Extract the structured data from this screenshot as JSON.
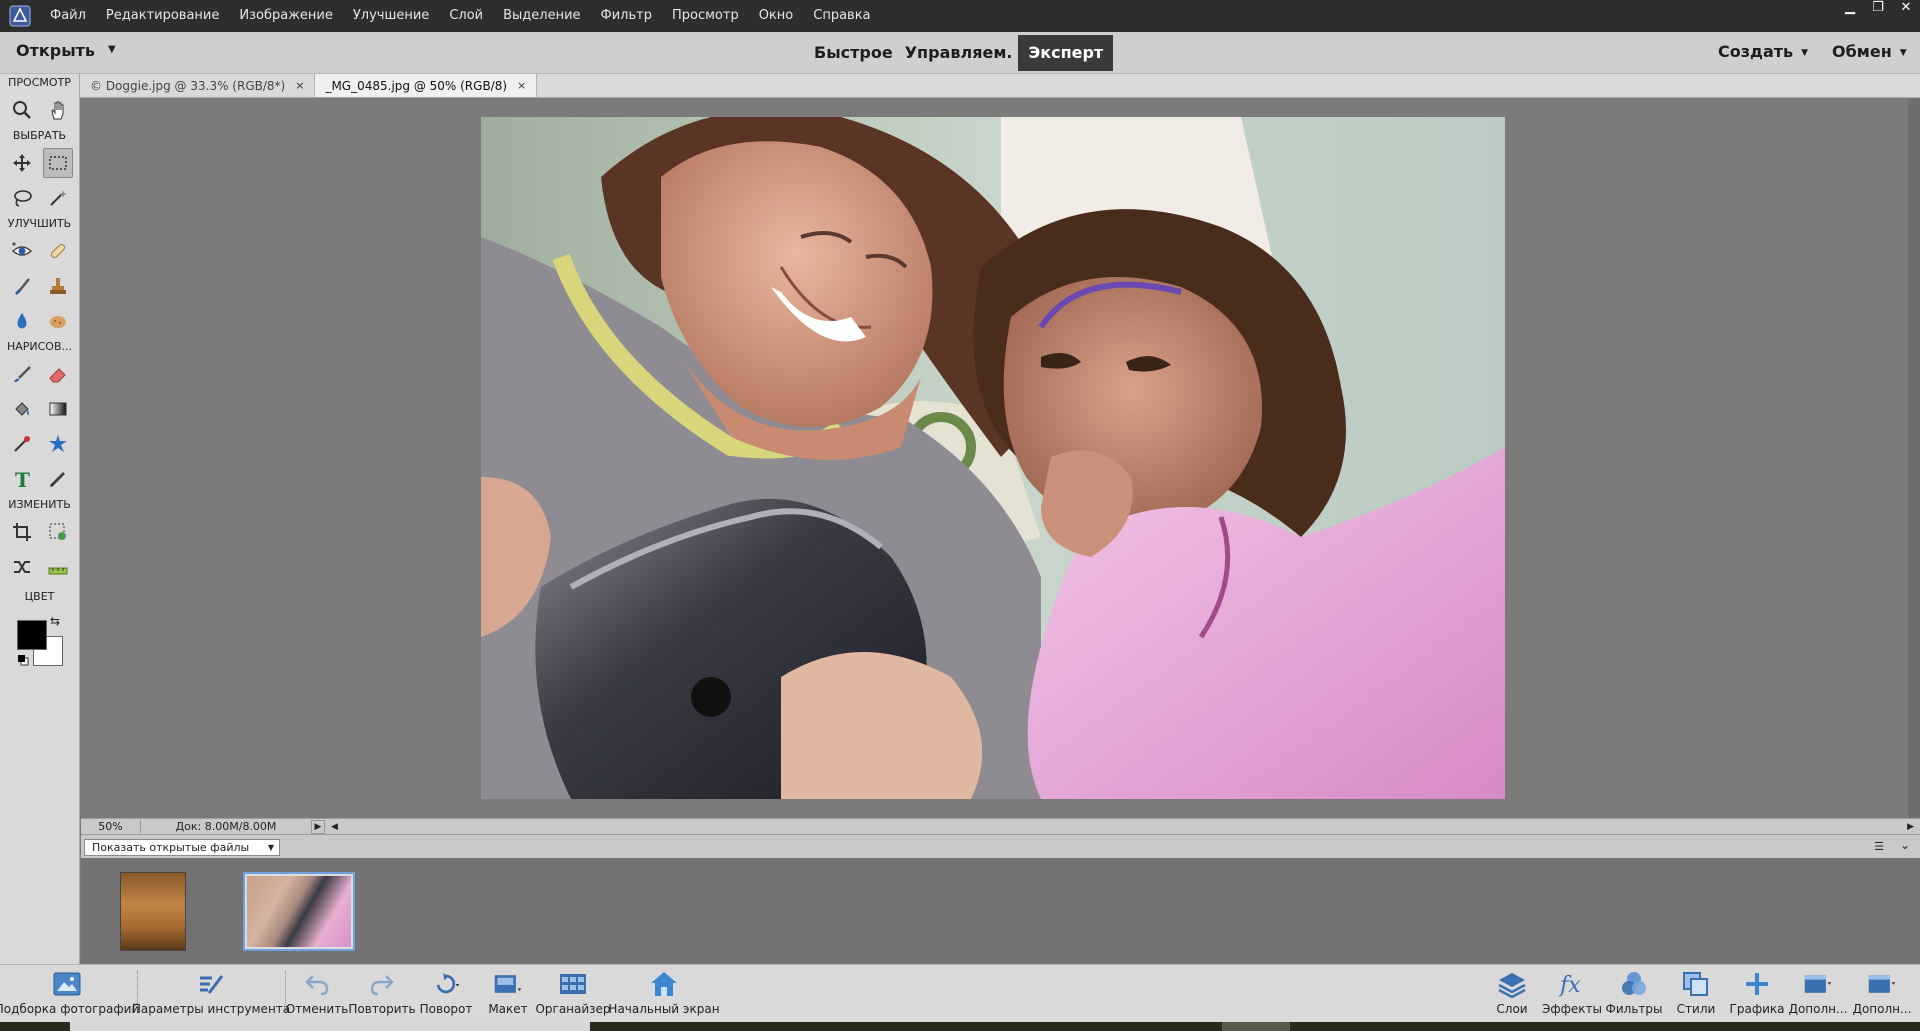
{
  "menu": {
    "items": [
      "Файл",
      "Редактирование",
      "Изображение",
      "Улучшение",
      "Слой",
      "Выделение",
      "Фильтр",
      "Просмотр",
      "Окно",
      "Справка"
    ]
  },
  "modebar": {
    "open_label": "Открыть",
    "modes": [
      "Быстрое",
      "Управляем.",
      "Эксперт"
    ],
    "active_mode": "Эксперт",
    "create_label": "Создать",
    "share_label": "Обмен"
  },
  "toolbox": {
    "sections": {
      "view": "ПРОСМОТР",
      "select": "ВЫБРАТЬ",
      "enhance": "УЛУЧШИТЬ",
      "draw": "НАРИСОВ...",
      "modify": "ИЗМЕНИТЬ",
      "color": "ЦВЕТ"
    },
    "fg_color": "#000000",
    "bg_color": "#ffffff"
  },
  "tabs": [
    {
      "label": "© Doggie.jpg @ 33.3% (RGB/8*)",
      "close": "×"
    },
    {
      "label": "_MG_0485.jpg @ 50% (RGB/8)",
      "close": "×"
    }
  ],
  "status": {
    "zoom": "50%",
    "doc_info": "Док: 8.00M/8.00M"
  },
  "bin": {
    "show_files_label": "Показать открытые файлы"
  },
  "taskbar": {
    "left": [
      {
        "label": "Подборка фотографий",
        "icon": "photo-bin-icon"
      },
      {
        "label": "Параметры инструмента",
        "icon": "tool-options-icon"
      },
      {
        "label": "Отменить",
        "icon": "undo-icon"
      },
      {
        "label": "Повторить",
        "icon": "redo-icon"
      },
      {
        "label": "Поворот",
        "icon": "rotate-icon"
      },
      {
        "label": "Макет",
        "icon": "layout-icon"
      },
      {
        "label": "Органайзер",
        "icon": "organizer-icon"
      },
      {
        "label": "Начальный экран",
        "icon": "home-icon"
      }
    ],
    "right": [
      {
        "label": "Слои",
        "icon": "layers-icon"
      },
      {
        "label": "Эффекты",
        "icon": "fx-icon"
      },
      {
        "label": "Фильтры",
        "icon": "filters-icon"
      },
      {
        "label": "Стили",
        "icon": "styles-icon"
      },
      {
        "label": "Графика",
        "icon": "graphics-icon"
      },
      {
        "label": "Дополн...",
        "icon": "more-icon"
      },
      {
        "label": "Дополн...",
        "icon": "more-icon"
      }
    ]
  }
}
